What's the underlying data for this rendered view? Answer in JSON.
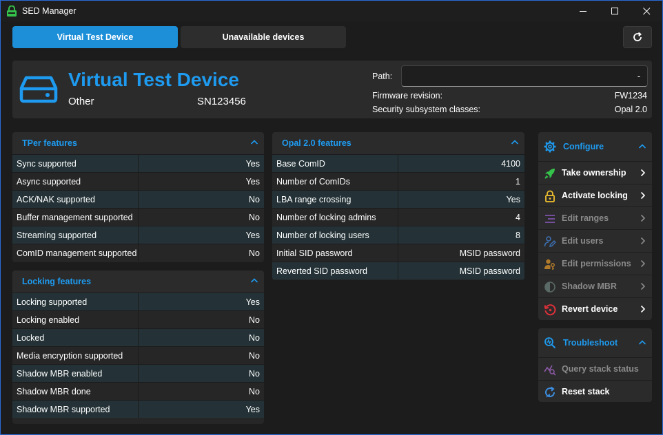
{
  "window": {
    "title": "SED Manager"
  },
  "tabs": [
    {
      "label": "Virtual Test Device",
      "active": true
    },
    {
      "label": "Unavailable devices",
      "active": false
    }
  ],
  "device": {
    "name": "Virtual Test Device",
    "type": "Other",
    "serial": "SN123456",
    "path_label": "Path:",
    "path_value": "-",
    "firmware_label": "Firmware revision:",
    "firmware_value": "FW1234",
    "ssc_label": "Security subsystem classes:",
    "ssc_value": "Opal 2.0"
  },
  "tper": {
    "title": "TPer features",
    "rows": [
      {
        "key": "Sync supported",
        "value": "Yes"
      },
      {
        "key": "Async supported",
        "value": "Yes"
      },
      {
        "key": "ACK/NAK supported",
        "value": "No"
      },
      {
        "key": "Buffer management supported",
        "value": "No"
      },
      {
        "key": "Streaming supported",
        "value": "Yes"
      },
      {
        "key": "ComID management supported",
        "value": "No"
      }
    ]
  },
  "locking": {
    "title": "Locking features",
    "rows": [
      {
        "key": "Locking supported",
        "value": "Yes"
      },
      {
        "key": "Locking enabled",
        "value": "No"
      },
      {
        "key": "Locked",
        "value": "No"
      },
      {
        "key": "Media encryption supported",
        "value": "No"
      },
      {
        "key": "Shadow MBR enabled",
        "value": "No"
      },
      {
        "key": "Shadow MBR done",
        "value": "No"
      },
      {
        "key": "Shadow MBR supported",
        "value": "Yes"
      }
    ]
  },
  "opal": {
    "title": "Opal 2.0 features",
    "rows": [
      {
        "key": "Base ComID",
        "value": "4100"
      },
      {
        "key": "Number of ComIDs",
        "value": "1"
      },
      {
        "key": "LBA range crossing",
        "value": "Yes"
      },
      {
        "key": "Number of locking admins",
        "value": "4"
      },
      {
        "key": "Number of locking users",
        "value": "8"
      },
      {
        "key": "Initial SID password",
        "value": "MSID password"
      },
      {
        "key": "Reverted SID password",
        "value": "MSID password"
      }
    ]
  },
  "configure": {
    "title": "Configure",
    "items": [
      {
        "label": "Take ownership",
        "icon": "rocket-icon",
        "enabled": true
      },
      {
        "label": "Activate locking",
        "icon": "lock-icon",
        "enabled": true
      },
      {
        "label": "Edit ranges",
        "icon": "ranges-icon",
        "enabled": false
      },
      {
        "label": "Edit users",
        "icon": "user-edit-icon",
        "enabled": false
      },
      {
        "label": "Edit permissions",
        "icon": "user-key-icon",
        "enabled": false
      },
      {
        "label": "Shadow MBR",
        "icon": "half-circle-icon",
        "enabled": false
      },
      {
        "label": "Revert device",
        "icon": "revert-icon",
        "enabled": true
      }
    ]
  },
  "troubleshoot": {
    "title": "Troubleshoot",
    "items": [
      {
        "label": "Query stack status",
        "icon": "chart-search-icon",
        "enabled": false
      },
      {
        "label": "Reset stack",
        "icon": "reset-icon",
        "enabled": true
      }
    ]
  },
  "colors": {
    "accent": "#1e9bf0",
    "tab_active": "#1d8fd8",
    "row_alt": "#243237",
    "green": "#35c24a",
    "yellow": "#f2c12e",
    "purple": "#7d52a8",
    "blue": "#3c8de0",
    "orange": "#d9902a",
    "red": "#e0303a"
  }
}
